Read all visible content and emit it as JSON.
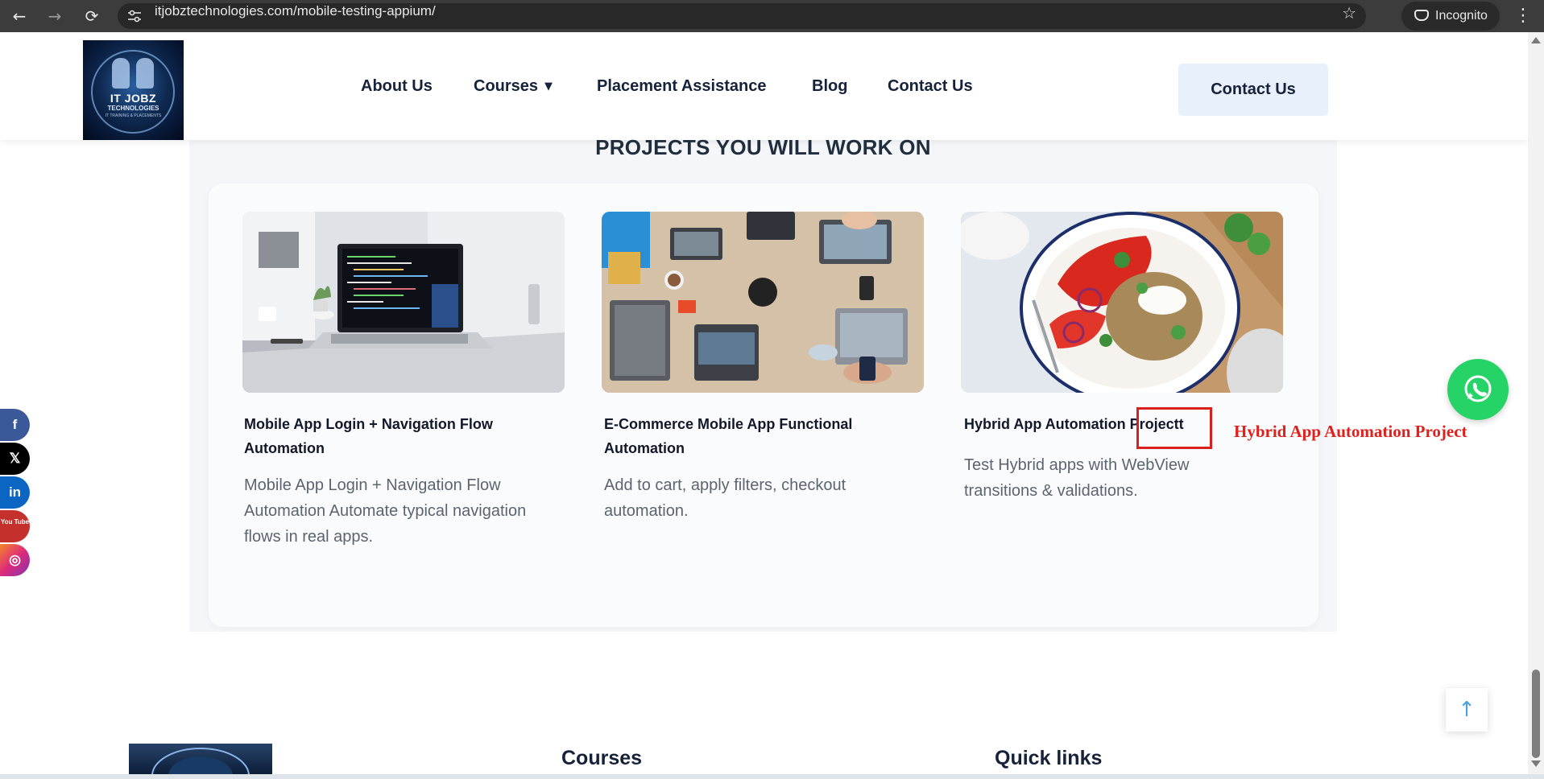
{
  "browser": {
    "url": "itjobztechnologies.com/mobile-testing-appium/",
    "incognito_label": "Incognito",
    "back_glyph": "←",
    "forward_glyph": "→",
    "reload_glyph": "⟳",
    "star_glyph": "☆",
    "menu_glyph": "⋮"
  },
  "logo": {
    "line1": "IT JOBZ",
    "line2": "TECHNOLOGIES",
    "line3": "IT TRAINING & PLACEMENTS"
  },
  "nav": {
    "items": [
      {
        "label": "About Us"
      },
      {
        "label": "Courses",
        "caret": "▼"
      },
      {
        "label": "Placement Assistance"
      },
      {
        "label": "Blog"
      },
      {
        "label": "Contact Us"
      }
    ],
    "cta_label": "Contact Us"
  },
  "section": {
    "title": "PROJECTS YOU WILL WORK ON"
  },
  "projects": [
    {
      "image_icon": "laptop-code-photo",
      "title": "Mobile App Login + Navigation Flow Automation",
      "description": "Mobile App Login + Navigation Flow Automation Automate typical navigation flows in real apps."
    },
    {
      "image_icon": "team-laptops-photo",
      "title": "E-Commerce Mobile App Functional Automation",
      "description": "Add to cart, apply filters, checkout automation."
    },
    {
      "image_icon": "salad-plate-photo",
      "title": "Hybrid App Automation Projectt",
      "description": "Test Hybrid apps with WebView transitions & validations."
    }
  ],
  "annotation": {
    "text": "Hybrid App Automation Project",
    "color": "#e0201c"
  },
  "social": [
    {
      "name": "facebook",
      "glyph": "f",
      "color": "#3b5998"
    },
    {
      "name": "x",
      "glyph": "𝕏",
      "color": "#000000"
    },
    {
      "name": "linkedin",
      "glyph": "in",
      "color": "#0a66c2"
    },
    {
      "name": "youtube",
      "glyph": "You Tube",
      "color": "#c4302b"
    },
    {
      "name": "instagram",
      "glyph": "◎",
      "color": "#e1306c"
    }
  ],
  "whatsapp_icon": "whatsapp-icon",
  "back_to_top_glyph": "↑",
  "footer": {
    "courses_heading": "Courses",
    "quick_links_heading": "Quick links"
  },
  "colors": {
    "whatsapp": "#25d366",
    "cta_bg": "#e8f0fb",
    "nav_text": "#16213a"
  }
}
